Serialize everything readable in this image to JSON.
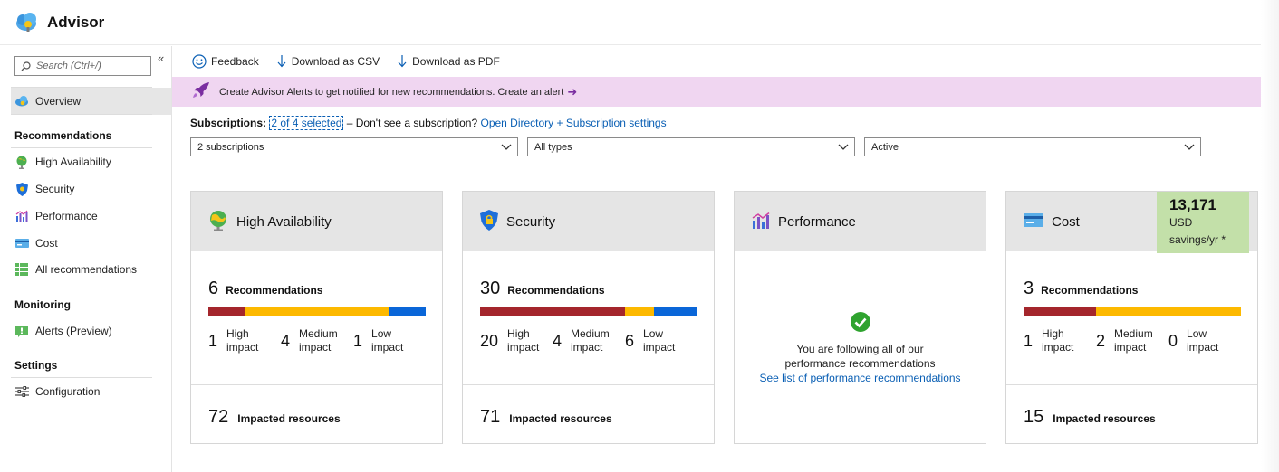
{
  "app": {
    "title": "Advisor"
  },
  "sidebar": {
    "search_placeholder": "Search (Ctrl+/)",
    "collapse_glyph": "«",
    "overview": "Overview",
    "sections": {
      "recommendations": "Recommendations",
      "monitoring": "Monitoring",
      "settings": "Settings"
    },
    "items": {
      "high_availability": "High Availability",
      "security": "Security",
      "performance": "Performance",
      "cost": "Cost",
      "all": "All recommendations",
      "alerts": "Alerts (Preview)",
      "configuration": "Configuration"
    }
  },
  "toolbar": {
    "feedback": "Feedback",
    "download_csv": "Download as CSV",
    "download_pdf": "Download as PDF"
  },
  "banner": {
    "text": "Create Advisor Alerts to get notified for new recommendations. Create an alert",
    "arrow": "➜"
  },
  "subscriptions": {
    "label": "Subscriptions:",
    "selected": "2 of 4 selected",
    "question": " – Don't see a subscription?",
    "link": "Open Directory + Subscription settings"
  },
  "filters": {
    "subscriptions": "2 subscriptions",
    "types": "All types",
    "status": "Active"
  },
  "colors": {
    "high": "#a4262c",
    "medium": "#fdb900",
    "low": "#0a66d8",
    "banner": "#f0d6f1",
    "savings": "#c3e0a9"
  },
  "cards": {
    "ha": {
      "title": "High Availability",
      "icon": "globe-icon",
      "recommendations": "6",
      "rec_label": "Recommendations",
      "high": "1",
      "medium": "4",
      "low": "1",
      "high_label_1": "High",
      "high_label_2": "impact",
      "medium_label_1": "Medium",
      "medium_label_2": "impact",
      "low_label_1": "Low",
      "low_label_2": "impact",
      "impacted": "72",
      "impacted_label": "Impacted resources"
    },
    "security": {
      "title": "Security",
      "icon": "shield-lock-icon",
      "recommendations": "30",
      "rec_label": "Recommendations",
      "high": "20",
      "medium": "4",
      "low": "6",
      "high_label_1": "High",
      "high_label_2": "impact",
      "medium_label_1": "Medium",
      "medium_label_2": "impact",
      "low_label_1": "Low",
      "low_label_2": "impact",
      "impacted": "71",
      "impacted_label": "Impacted resources"
    },
    "performance": {
      "title": "Performance",
      "icon": "performance-chart-icon",
      "message": "You are following all of our performance recommendations",
      "link": "See list of performance recommendations"
    },
    "cost": {
      "title": "Cost",
      "icon": "credit-card-icon",
      "savings_amount": "13,171",
      "savings_currency": "USD",
      "savings_period": "savings/yr *",
      "recommendations": "3",
      "rec_label": "Recommendations",
      "high": "1",
      "medium": "2",
      "low": "0",
      "high_label_1": "High",
      "high_label_2": "impact",
      "medium_label_1": "Medium",
      "medium_label_2": "impact",
      "low_label_1": "Low",
      "low_label_2": "impact",
      "impacted": "15",
      "impacted_label": "Impacted resources"
    }
  }
}
